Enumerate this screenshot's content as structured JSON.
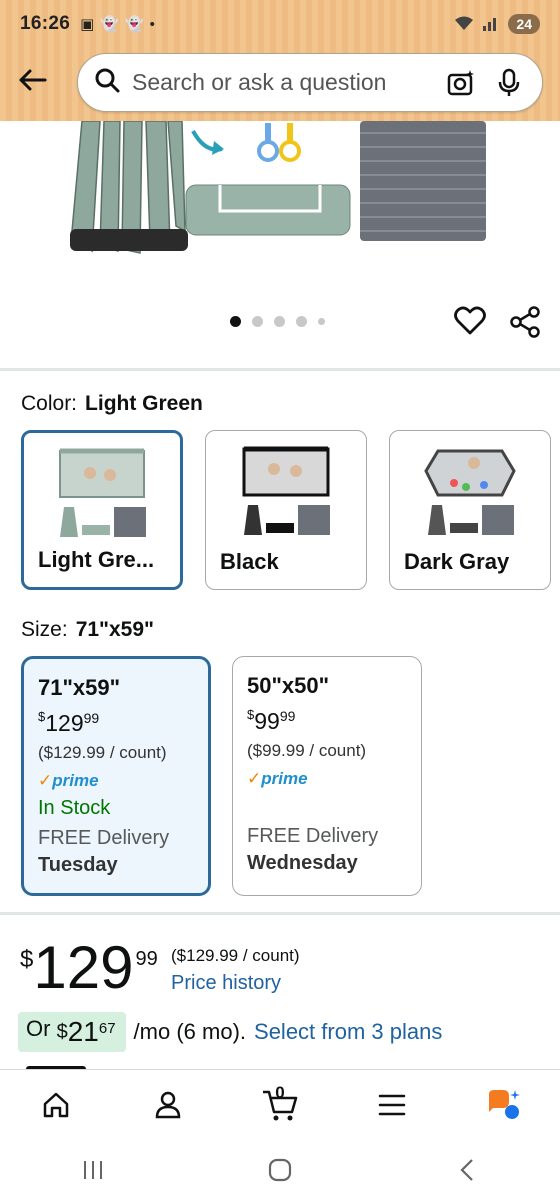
{
  "status_bar": {
    "time": "16:26",
    "battery": "24"
  },
  "search": {
    "placeholder": "Search or ask a question"
  },
  "carousel": {
    "page_count": 5,
    "active_index": 0
  },
  "color": {
    "label": "Color:",
    "selected": "Light Green",
    "options": [
      {
        "name": "Light Gre...",
        "selected": true
      },
      {
        "name": "Black",
        "selected": false
      },
      {
        "name": "Dark Gray",
        "selected": false
      }
    ]
  },
  "size": {
    "label": "Size:",
    "selected": "71\"x59\"",
    "options": [
      {
        "name": "71\"x59\"",
        "currency": "$",
        "price_whole": "129",
        "price_cents": "99",
        "unit_price": "($129.99 / count)",
        "prime": "prime",
        "stock": "In Stock",
        "delivery": "FREE Delivery",
        "delivery_day": "Tuesday",
        "selected": true
      },
      {
        "name": "50\"x50\"",
        "currency": "$",
        "price_whole": "99",
        "price_cents": "99",
        "unit_price": "($99.99 / count)",
        "prime": "prime",
        "stock": "",
        "delivery": "FREE Delivery",
        "delivery_day": "Wednesday",
        "selected": false
      }
    ]
  },
  "price": {
    "currency": "$",
    "whole": "129",
    "cents": "99",
    "unit_price": "($129.99 / count)",
    "history_link": "Price history"
  },
  "monthly": {
    "prefix": "Or",
    "currency": "$",
    "whole": "21",
    "cents": "67",
    "suffix": "/mo (6 mo).",
    "link": "Select from 3 plans"
  },
  "nav": {
    "cart_count": "0"
  },
  "colors": {
    "accent_blue": "#2b6a9a",
    "link_blue": "#2162a1",
    "stock_green": "#007600",
    "prime_blue": "#1f8fce",
    "header_orange": "#f2c58f"
  }
}
